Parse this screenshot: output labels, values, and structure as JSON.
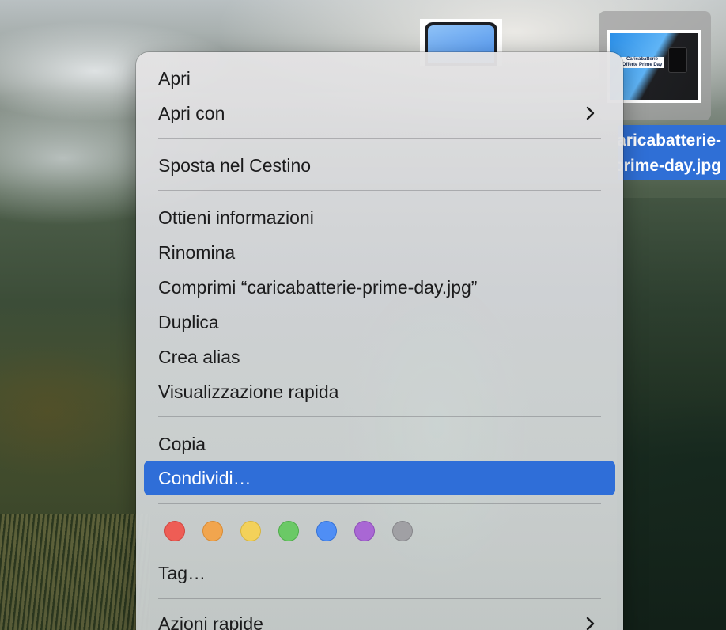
{
  "file": {
    "label_line1": "caricabatterie-",
    "label_line2": "prime-day.jpg",
    "thumbnail_text": "Caricabatterie Offerte Prime Day"
  },
  "menu": {
    "open": "Apri",
    "open_with": "Apri con",
    "move_to_trash": "Sposta nel Cestino",
    "get_info": "Ottieni informazioni",
    "rename": "Rinomina",
    "compress": "Comprimi “caricabatterie-prime-day.jpg”",
    "duplicate": "Duplica",
    "make_alias": "Crea alias",
    "quick_look": "Visualizzazione rapida",
    "copy": "Copia",
    "share": "Condividi…",
    "tags": "Tag…",
    "quick_actions": "Azioni rapide",
    "highlighted_item": "share"
  },
  "tag_colors": [
    {
      "name": "red",
      "fill": "#ee5d55",
      "border": "#d24740"
    },
    {
      "name": "orange",
      "fill": "#f1a54e",
      "border": "#d88b35"
    },
    {
      "name": "yellow",
      "fill": "#f3d15a",
      "border": "#d8b53e"
    },
    {
      "name": "green",
      "fill": "#6bc966",
      "border": "#4fae4a"
    },
    {
      "name": "blue",
      "fill": "#4f8ef5",
      "border": "#3472d8"
    },
    {
      "name": "purple",
      "fill": "#a967d4",
      "border": "#8d4fb8"
    },
    {
      "name": "gray",
      "fill": "#a0a0a4",
      "border": "#86868a"
    }
  ],
  "colors": {
    "selection": "#2f6ed8",
    "menu_text": "#1b1b1c"
  }
}
